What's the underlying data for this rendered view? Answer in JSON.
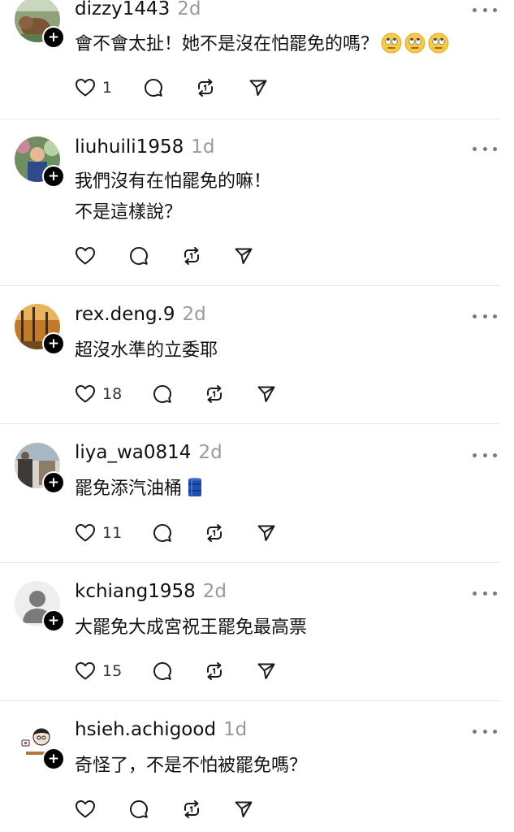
{
  "comments": [
    {
      "username": "dizzy1443",
      "time": "2d",
      "lines": [
        "會不會太扯！她不是沒在怕罷免的嗎？"
      ],
      "emoji": "face-with-rolling-eyes x3",
      "likes": "1"
    },
    {
      "username": "liuhuili1958",
      "time": "1d",
      "lines": [
        "我們沒有在怕罷免的嘛！",
        "不是這樣說？"
      ],
      "likes": ""
    },
    {
      "username": "rex.deng.9",
      "time": "2d",
      "lines": [
        "超沒水準的立委耶"
      ],
      "likes": "18"
    },
    {
      "username": "liya_wa0814",
      "time": "2d",
      "lines": [
        "罷免添汽油桶"
      ],
      "emoji": "oil-drum",
      "likes": "11"
    },
    {
      "username": "kchiang1958",
      "time": "2d",
      "lines": [
        "大罷免大成宮祝王罷免最高票"
      ],
      "likes": "15"
    },
    {
      "username": "hsieh.achigood",
      "time": "1d",
      "lines": [
        "奇怪了，不是不怕被罷免嗎？"
      ],
      "likes": ""
    }
  ],
  "icons": {
    "like": "heart-icon",
    "reply": "comment-bubble-icon",
    "repost": "repost-icon",
    "share": "send-icon",
    "more": "more-dots-icon",
    "follow": "plus-icon"
  },
  "colors": {
    "text": "#111111",
    "muted": "#9a9a9a",
    "divider": "#e6e6e6",
    "icon": "#1a1a1a"
  }
}
